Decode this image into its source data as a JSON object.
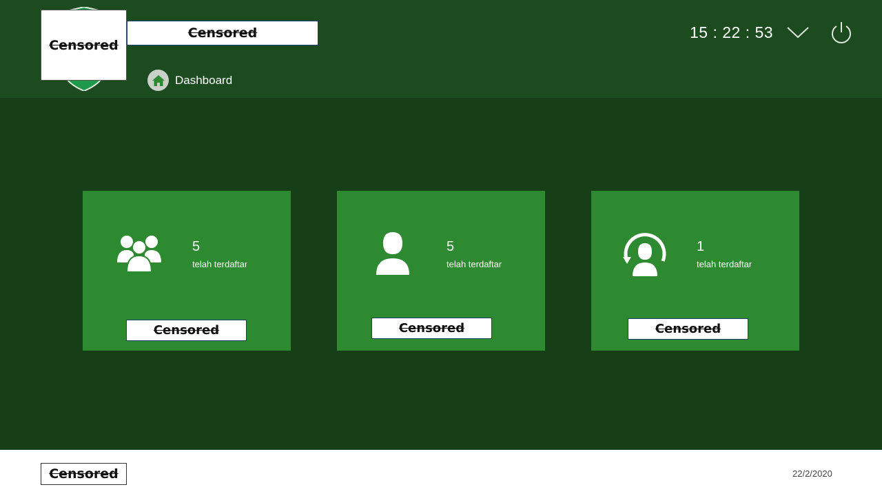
{
  "header": {
    "logo_label": "Censored",
    "title": "Censored",
    "nav": {
      "dashboard_label": "Dashboard"
    },
    "clock": "15 : 22 : 53",
    "icons": [
      "home-icon",
      "chevron-down-icon",
      "power-icon"
    ]
  },
  "cards": [
    {
      "count": "5",
      "subtitle": "telah terdaftar",
      "label": "Censored",
      "icon": "group-icon"
    },
    {
      "count": "5",
      "subtitle": "telah terdaftar",
      "label": "Censored",
      "icon": "user-icon"
    },
    {
      "count": "1",
      "subtitle": "telah terdaftar",
      "label": "Censored",
      "icon": "user-sync-icon"
    }
  ],
  "footer": {
    "label": "Censored",
    "date": "22/2/2020"
  },
  "colors": {
    "header_bg": "#1b4b1e",
    "body_bg": "#163f17",
    "card_bg": "#2e8a31",
    "footer_bg": "#ffffff"
  }
}
